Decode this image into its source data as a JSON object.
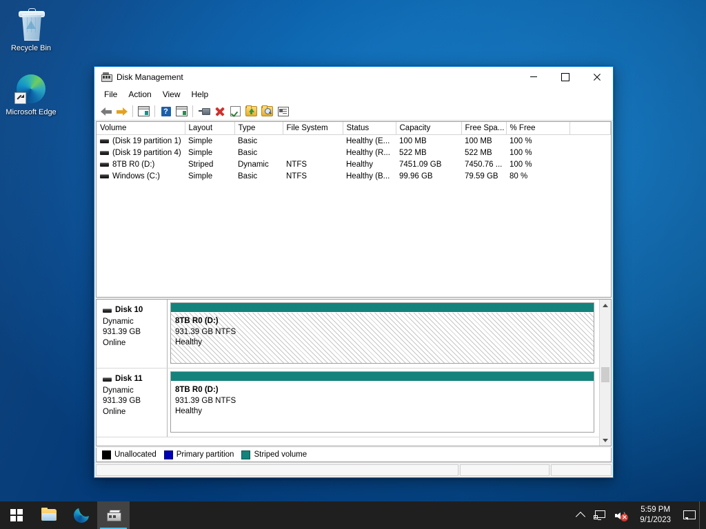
{
  "desktop": {
    "icons": [
      {
        "name": "recycle-bin",
        "label": "Recycle Bin"
      },
      {
        "name": "microsoft-edge",
        "label": "Microsoft Edge"
      }
    ]
  },
  "window": {
    "title": "Disk Management",
    "icon": "disk-management-icon",
    "controls": {
      "minimize": "Minimize",
      "maximize": "Maximize",
      "close": "Close"
    },
    "menu": [
      "File",
      "Action",
      "View",
      "Help"
    ],
    "toolbar": [
      {
        "name": "back-button",
        "icon": "left-arrow-icon"
      },
      {
        "name": "forward-button",
        "icon": "right-arrow-icon"
      },
      {
        "name": "show-hide-console-tree-button",
        "icon": "console-tree-icon"
      },
      {
        "name": "help-button",
        "icon": "help-question-icon"
      },
      {
        "name": "show-hide-action-pane-button",
        "icon": "action-pane-icon"
      },
      {
        "name": "connect-to-another-computer-button",
        "icon": "connect-icon"
      },
      {
        "name": "delete-button",
        "icon": "red-x-icon"
      },
      {
        "name": "rescan-disks-button",
        "icon": "checkbox-check-icon"
      },
      {
        "name": "import-foreign-disks-button",
        "icon": "folder-up-arrow-icon"
      },
      {
        "name": "explore-button",
        "icon": "folder-magnifier-icon"
      },
      {
        "name": "properties-button",
        "icon": "properties-list-icon"
      }
    ]
  },
  "volume_list": {
    "columns": [
      "Volume",
      "Layout",
      "Type",
      "File System",
      "Status",
      "Capacity",
      "Free Spa...",
      "% Free"
    ],
    "rows": [
      {
        "volume": "(Disk 19 partition 1)",
        "layout": "Simple",
        "type": "Basic",
        "file_system": "",
        "status": "Healthy (E...",
        "capacity": "100 MB",
        "free_space": "100 MB",
        "percent_free": "100 %"
      },
      {
        "volume": "(Disk 19 partition 4)",
        "layout": "Simple",
        "type": "Basic",
        "file_system": "",
        "status": "Healthy (R...",
        "capacity": "522 MB",
        "free_space": "522 MB",
        "percent_free": "100 %"
      },
      {
        "volume": "8TB R0 (D:)",
        "layout": "Striped",
        "type": "Dynamic",
        "file_system": "NTFS",
        "status": "Healthy",
        "capacity": "7451.09 GB",
        "free_space": "7450.76 ...",
        "percent_free": "100 %"
      },
      {
        "volume": "Windows (C:)",
        "layout": "Simple",
        "type": "Basic",
        "file_system": "NTFS",
        "status": "Healthy (B...",
        "capacity": "99.96 GB",
        "free_space": "79.59 GB",
        "percent_free": "80 %"
      }
    ]
  },
  "graphical_view": {
    "disks": [
      {
        "name": "Disk 10",
        "type": "Dynamic",
        "size": "931.39 GB",
        "status": "Online",
        "volume": {
          "title": "8TB R0  (D:)",
          "size_fs": "931.39 GB NTFS",
          "health": "Healthy",
          "bar_color": "#14837c",
          "pattern": "hatched"
        }
      },
      {
        "name": "Disk 11",
        "type": "Dynamic",
        "size": "931.39 GB",
        "status": "Online",
        "volume": {
          "title": "8TB R0  (D:)",
          "size_fs": "931.39 GB NTFS",
          "health": "Healthy",
          "bar_color": "#14837c",
          "pattern": "solid"
        }
      }
    ],
    "scrollbar": {
      "up": "scroll-up",
      "down": "scroll-down",
      "thumb": "scroll-thumb"
    }
  },
  "legend": [
    {
      "label": "Unallocated",
      "color": "#000000"
    },
    {
      "label": "Primary partition",
      "color": "#0000b4"
    },
    {
      "label": "Striped volume",
      "color": "#14837c"
    }
  ],
  "statusbar": {
    "pane1": "",
    "pane2": "",
    "pane3": ""
  },
  "taskbar": {
    "start": "Start",
    "buttons": [
      {
        "name": "file-explorer",
        "label": "File Explorer"
      },
      {
        "name": "microsoft-edge",
        "label": "Microsoft Edge"
      },
      {
        "name": "disk-management",
        "label": "Disk Management"
      }
    ],
    "tray": {
      "show_hidden_icons": "Show hidden icons",
      "network": "Network",
      "volume": "Volume (muted)",
      "time": "5:59 PM",
      "date": "9/1/2023",
      "action_center": "Notifications"
    }
  }
}
